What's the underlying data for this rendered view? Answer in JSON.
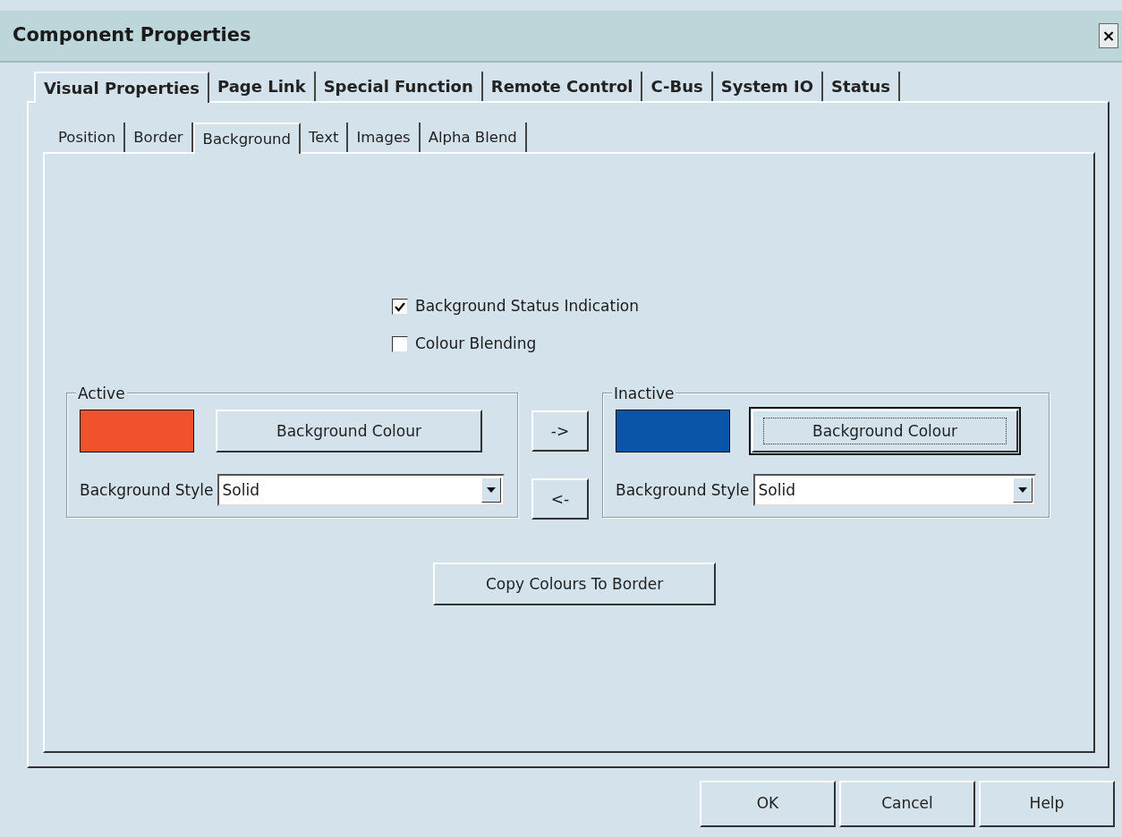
{
  "window": {
    "title": "Component Properties",
    "close": "×"
  },
  "tabs": [
    {
      "label": "Visual Properties",
      "selected": true
    },
    {
      "label": "Page Link",
      "selected": false
    },
    {
      "label": "Special Function",
      "selected": false
    },
    {
      "label": "Remote Control",
      "selected": false
    },
    {
      "label": "C-Bus",
      "selected": false
    },
    {
      "label": "System IO",
      "selected": false
    },
    {
      "label": "Status",
      "selected": false
    }
  ],
  "subtabs": [
    {
      "label": "Position",
      "selected": false
    },
    {
      "label": "Border",
      "selected": false
    },
    {
      "label": "Background",
      "selected": true
    },
    {
      "label": "Text",
      "selected": false
    },
    {
      "label": "Images",
      "selected": false
    },
    {
      "label": "Alpha Blend",
      "selected": false
    }
  ],
  "options": [
    {
      "label": "Background Status Indication",
      "checked": true
    },
    {
      "label": "Colour Blending",
      "checked": false
    }
  ],
  "groups": [
    {
      "title": "Active",
      "color": "#f0532b",
      "button": "Background Colour",
      "focused": false,
      "style_label": "Background Style",
      "style_value": "Solid"
    },
    {
      "title": "Inactive",
      "color": "#0b55a8",
      "button": "Background Colour",
      "focused": true,
      "style_label": "Background Style",
      "style_value": "Solid"
    }
  ],
  "transfer_buttons": [
    "->",
    "<-"
  ],
  "copy_button": "Copy Colours To Border",
  "buttons": [
    "OK",
    "Cancel",
    "Help"
  ]
}
